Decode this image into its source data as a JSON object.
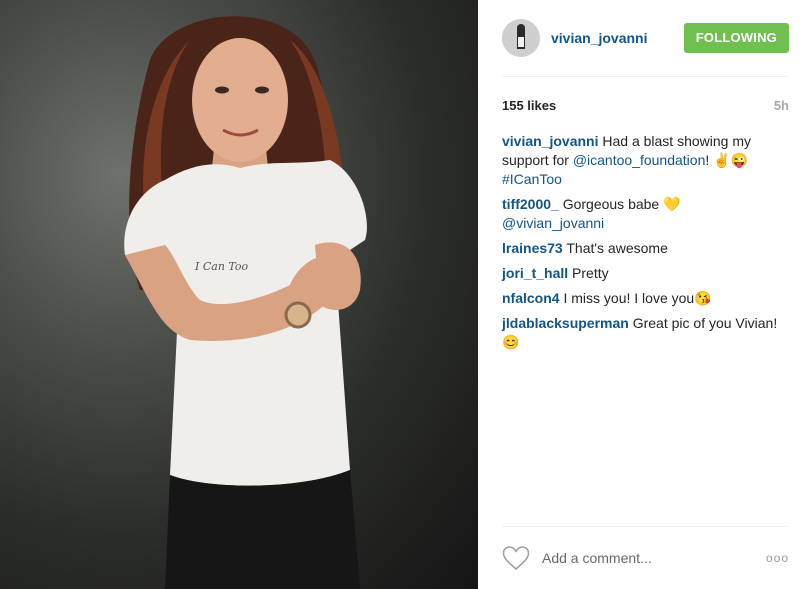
{
  "post": {
    "author": "vivian_jovanni",
    "follow_label": "FOLLOWING",
    "likes": "155 likes",
    "time_ago": "5h",
    "photo_shirt_text": "I Can Too",
    "colors": {
      "follow_button": "#70c050",
      "username": "#125688"
    }
  },
  "caption": {
    "user": "vivian_jovanni",
    "text_before": "Had a blast showing my support for ",
    "mention": "@icantoo_foundation",
    "text_after": "! ✌😜",
    "hashtag": "#ICanToo"
  },
  "comments": [
    {
      "user": "tiff2000_",
      "text": "Gorgeous babe 💛",
      "mention": "@vivian_jovanni"
    },
    {
      "user": "lraines73",
      "text": "That's awesome"
    },
    {
      "user": "jori_t_hall",
      "text": "Pretty"
    },
    {
      "user": "nfalcon4",
      "text": "I miss you! I love you😘"
    },
    {
      "user": "jldablacksuperman",
      "text": "Great pic of you Vivian! 😊"
    }
  ],
  "footer": {
    "comment_placeholder": "Add a comment...",
    "more_label": "ooo",
    "like_icon": "heart-icon",
    "more_icon": "more-options-icon"
  }
}
